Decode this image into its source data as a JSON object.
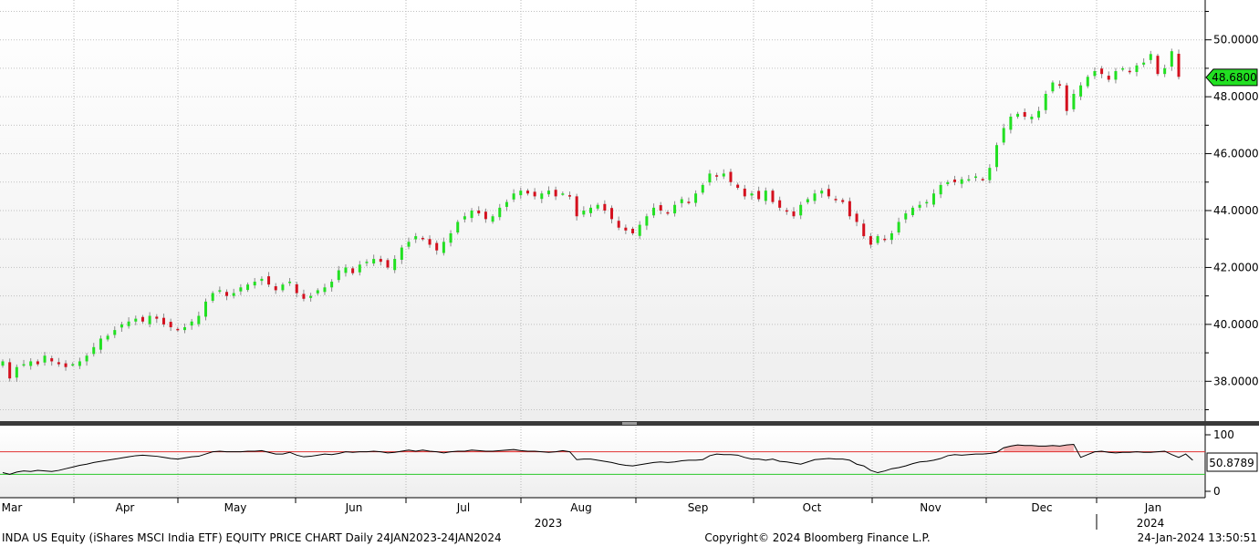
{
  "footer": {
    "left": "INDA US Equity (iShares MSCI India ETF) EQUITY PRICE CHART  Daily 24JAN2023-24JAN2024",
    "center": "Copyright© 2024 Bloomberg Finance L.P.",
    "right": "24-Jan-2024 13:50:51"
  },
  "chart_data": [
    {
      "type": "candlestick",
      "title": "",
      "x_tick_labels": [
        "Mar",
        "Apr",
        "May",
        "Jun",
        "Jul",
        "Aug",
        "Sep",
        "Oct",
        "Nov",
        "Dec",
        "Jan"
      ],
      "year_labels": [
        "2023",
        "2024"
      ],
      "y_ticks": [
        "38.0000",
        "40.0000",
        "42.0000",
        "44.0000",
        "46.0000",
        "48.0000",
        "50.0000"
      ],
      "ylim": [
        36.6,
        51.4
      ],
      "last_price": 48.68,
      "last_price_label": "48.6800",
      "colors": {
        "up": "#22e022",
        "down": "#d4101e",
        "last_tag": "#22e022"
      },
      "grid": true,
      "series": [
        {
          "values": [
            38.7,
            38.1,
            38.5,
            38.6,
            38.7,
            38.6,
            38.9,
            38.7,
            38.6,
            38.5,
            38.6,
            38.7,
            38.9,
            39.2,
            39.5,
            39.6,
            39.8,
            40.0,
            40.1,
            40.2,
            40.1,
            40.3,
            40.2,
            40.0,
            39.9,
            39.8,
            39.9,
            40.1,
            40.3,
            40.8,
            41.1,
            41.2,
            41.0,
            41.1,
            41.3,
            41.4,
            41.5,
            41.6,
            41.4,
            41.2,
            41.4,
            41.5,
            41.1,
            40.9,
            41.0,
            41.2,
            41.3,
            41.5,
            41.9,
            42.0,
            41.8,
            42.1,
            42.2,
            42.3,
            42.2,
            42.0,
            42.3,
            42.7,
            42.9,
            43.1,
            43.0,
            42.8,
            42.6,
            42.9,
            43.2,
            43.6,
            43.8,
            44.0,
            43.9,
            43.7,
            43.8,
            44.1,
            44.3,
            44.6,
            44.7,
            44.6,
            44.5,
            44.6,
            44.7,
            44.5,
            44.6,
            44.5,
            43.8,
            44.0,
            44.1,
            44.2,
            44.0,
            43.7,
            43.4,
            43.3,
            43.2,
            43.5,
            43.8,
            44.1,
            44.0,
            43.9,
            44.2,
            44.4,
            44.3,
            44.6,
            44.9,
            45.3,
            45.2,
            45.3,
            45.0,
            44.8,
            44.5,
            44.6,
            44.4,
            44.7,
            44.3,
            44.1,
            44.0,
            43.8,
            44.2,
            44.4,
            44.6,
            44.7,
            44.5,
            44.4,
            44.3,
            43.8,
            43.6,
            43.1,
            42.8,
            43.1,
            43.0,
            43.2,
            43.6,
            43.9,
            44.1,
            44.2,
            44.3,
            44.6,
            44.9,
            45.0,
            45.0,
            45.1,
            45.1,
            45.2,
            45.1,
            45.5,
            46.3,
            46.9,
            47.3,
            47.4,
            47.3,
            47.3,
            47.5,
            48.1,
            48.5,
            48.4,
            47.5,
            48.1,
            48.4,
            48.7,
            48.9,
            48.8,
            48.6,
            48.9,
            49.0,
            48.9,
            49.1,
            49.2,
            49.5,
            48.8,
            49.0,
            49.6,
            48.7
          ]
        }
      ]
    },
    {
      "type": "line",
      "title": "",
      "y_ticks": [
        "100",
        "0"
      ],
      "ylim": [
        0,
        100
      ],
      "upper_band": 70,
      "lower_band": 30,
      "last_value_label": "50.8789",
      "colors": {
        "line": "#000000",
        "upper_band": "#e03030",
        "lower_band": "#28c828",
        "fill": "#f4b4b4"
      },
      "series": [
        {
          "values": [
            33,
            30,
            34,
            36,
            35,
            37,
            36,
            35,
            37,
            40,
            43,
            46,
            48,
            51,
            53,
            55,
            57,
            59,
            61,
            63,
            64,
            63,
            62,
            60,
            58,
            57,
            59,
            61,
            62,
            66,
            70,
            71,
            70,
            70,
            70,
            71,
            71,
            72,
            69,
            66,
            66,
            69,
            64,
            61,
            62,
            64,
            66,
            65,
            67,
            70,
            69,
            70,
            70,
            71,
            70,
            68,
            69,
            71,
            73,
            71,
            73,
            71,
            70,
            68,
            70,
            71,
            71,
            73,
            72,
            71,
            71,
            72,
            73,
            74,
            72,
            71,
            71,
            70,
            69,
            70,
            72,
            70,
            56,
            57,
            57,
            55,
            53,
            51,
            48,
            46,
            45,
            47,
            49,
            51,
            52,
            51,
            52,
            54,
            55,
            55,
            56,
            63,
            66,
            65,
            65,
            64,
            60,
            57,
            57,
            55,
            57,
            53,
            52,
            50,
            48,
            52,
            56,
            57,
            58,
            57,
            57,
            55,
            48,
            45,
            37,
            33,
            36,
            40,
            42,
            45,
            49,
            52,
            53,
            55,
            58,
            63,
            65,
            64,
            65,
            66,
            66,
            67,
            69,
            77,
            80,
            82,
            81,
            81,
            80,
            80,
            81,
            80,
            82,
            83,
            60,
            65,
            70,
            71,
            69,
            68,
            69,
            69,
            70,
            69,
            69,
            70,
            71,
            65,
            60,
            66,
            55
          ]
        }
      ]
    }
  ]
}
